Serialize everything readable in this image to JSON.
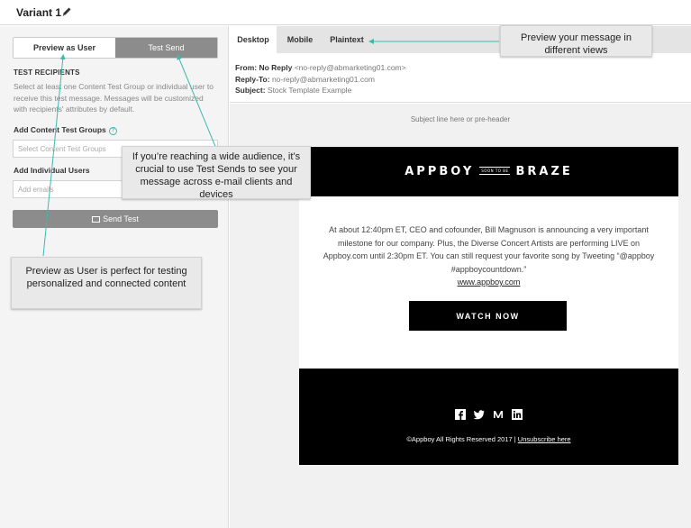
{
  "header": {
    "title": "Variant 1",
    "edit_icon": "pencil-icon"
  },
  "left_panel": {
    "segmented": {
      "preview_label": "Preview as User",
      "test_send_label": "Test Send"
    },
    "section_title": "TEST RECIPIENTS",
    "help_text": "Select at least one Content Test Group or individual user to receive this test message. Messages will be customized with recipients' attributes by default.",
    "groups_label": "Add Content Test Groups",
    "groups_placeholder": "Select Content Test Groups",
    "users_label": "Add Individual Users",
    "users_placeholder": "Add emails",
    "send_button": "Send Test"
  },
  "tabs": [
    {
      "label": "Desktop"
    },
    {
      "label": "Mobile"
    },
    {
      "label": "Plaintext"
    }
  ],
  "message_headers": {
    "from_label": "From:",
    "from_name": "No Reply",
    "from_email": "<no-reply@abmarketing01.com>",
    "reply_label": "Reply-To:",
    "reply_value": "no-reply@abmarketing01.com",
    "subject_label": "Subject:",
    "subject_value": "Stock Template Example"
  },
  "preview": {
    "preheader": "Subject line here or pre-header",
    "logo_left": "APPBOY",
    "logo_mid": "SOON TO BE",
    "logo_right": "BRAZE",
    "body": "At about 12:40pm ET, CEO and cofounder, Bill Magnuson is announcing a very important milestone for our company. Plus, the Diverse Concert Artists are performing LIVE on Appboy.com until 2:30pm ET. You can still request your favorite song by Tweeting “@appboy #appboycountdown.”",
    "link": "www.appboy.com",
    "cta": "WATCH NOW",
    "copyright": "©Appboy All Rights Reserved 2017 |",
    "unsubscribe": "Unsubscribe here",
    "social_icons": [
      "facebook-icon",
      "twitter-icon",
      "medium-icon",
      "linkedin-icon"
    ]
  },
  "callouts": {
    "views": "Preview your message in different views",
    "test_send": "If you’re reaching a wide audience, it’s crucial to use Test Sends to see your message across e-mail clients and devices",
    "preview_user": "Preview as User is perfect for testing personalized and connected content"
  },
  "colors": {
    "accent": "#3fb8b0",
    "button_gray": "#8c8c8c",
    "email_black": "#000000"
  }
}
